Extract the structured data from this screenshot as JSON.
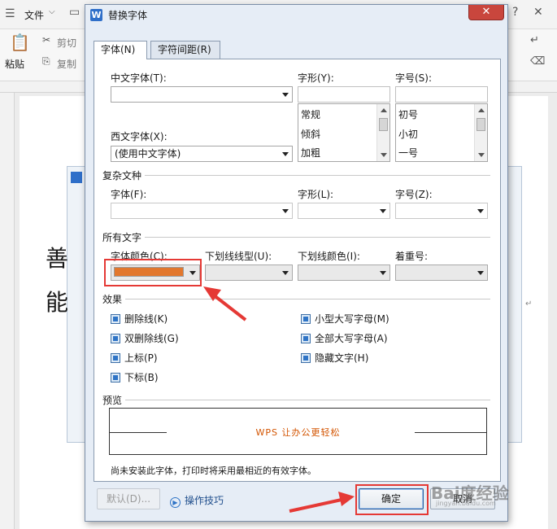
{
  "app": {
    "file_menu": "文件",
    "cut": "剪切",
    "copy": "复制",
    "paste": "粘贴",
    "doc_chars": [
      "善",
      "能"
    ]
  },
  "dialog": {
    "title": "替换字体",
    "close_glyph": "✕",
    "tabs": [
      {
        "label": "字体(N)"
      },
      {
        "label": "字符间距(R)"
      }
    ],
    "chinese_font": {
      "label": "中文字体(T):",
      "value": ""
    },
    "style": {
      "label": "字形(Y):",
      "input": "",
      "options": [
        "常规",
        "倾斜",
        "加粗"
      ]
    },
    "size": {
      "label": "字号(S):",
      "input": "",
      "options": [
        "初号",
        "小初",
        "一号"
      ]
    },
    "western_font": {
      "label": "西文字体(X):",
      "value": "(使用中文字体)"
    },
    "complex": {
      "section": "复杂文种",
      "font_label": "字体(F):",
      "style_label": "字形(L):",
      "size_label": "字号(Z):"
    },
    "all_text": {
      "section": "所有文字",
      "color_label": "字体颜色(C):",
      "color_value": "#e2772d",
      "underline_type_label": "下划线线型(U):",
      "underline_color_label": "下划线颜色(I):",
      "emphasis_label": "着重号:"
    },
    "effects": {
      "section": "效果",
      "items": [
        "删除线(K)",
        "双删除线(G)",
        "上标(P)",
        "下标(B)",
        "小型大写字母(M)",
        "全部大写字母(A)",
        "隐藏文字(H)"
      ]
    },
    "preview": {
      "section": "预览",
      "sample": "WPS 让办公更轻松",
      "note": "尚未安装此字体，打印时将采用最相近的有效字体。"
    },
    "buttons": {
      "default": "默认(D)...",
      "tips": "操作技巧",
      "ok": "确定",
      "cancel": "取消"
    }
  },
  "annotations": {
    "highlight_color": "#e53935"
  },
  "watermark": {
    "text": "Bai度经验",
    "sub": "jingyan.baidu.com"
  }
}
